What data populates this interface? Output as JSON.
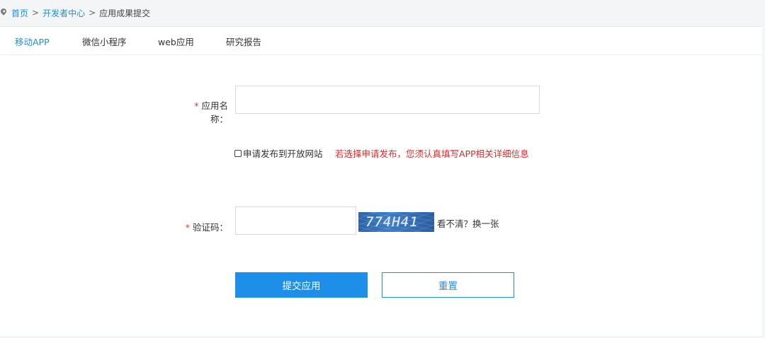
{
  "breadcrumb": {
    "items": [
      {
        "label": "首页"
      },
      {
        "label": "开发者中心"
      }
    ],
    "separator": ">",
    "current": "应用成果提交"
  },
  "tabs": [
    {
      "label": "移动APP",
      "active": true
    },
    {
      "label": "微信小程序",
      "active": false
    },
    {
      "label": "web应用",
      "active": false
    },
    {
      "label": "研究报告",
      "active": false
    }
  ],
  "form": {
    "required_mark": "*",
    "app_name_label": "应用名称：",
    "app_name_value": "",
    "publish_checkbox_label": "申请发布到开放网站",
    "publish_checked": false,
    "publish_warning": "若选择申请发布，您须认真填写APP相关详细信息",
    "captcha_label": "验证码：",
    "captcha_value": "",
    "captcha_image_text": "774H41",
    "captcha_refresh": "看不清？换一张",
    "submit_label": "提交应用",
    "reset_label": "重置"
  },
  "colors": {
    "accent": "#1e8fe1",
    "warning": "#d32f2f",
    "required": "#e53935"
  }
}
